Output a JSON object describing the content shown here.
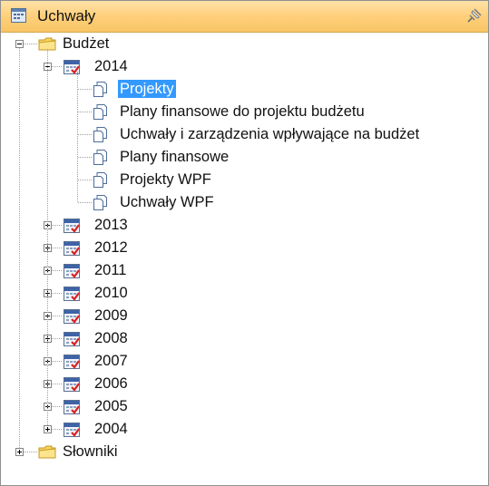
{
  "panel": {
    "title": "Uchwały"
  },
  "tree": {
    "root_budzet": "Budżet",
    "year_2014": "2014",
    "docs_2014": [
      "Projekty",
      "Plany finansowe do projektu budżetu",
      "Uchwały i zarządzenia wpływające na budżet",
      "Plany finansowe",
      "Projekty WPF",
      "Uchwały WPF"
    ],
    "years": [
      "2013",
      "2012",
      "2011",
      "2010",
      "2009",
      "2008",
      "2007",
      "2006",
      "2005",
      "2004"
    ],
    "root_slowniki": "Słowniki",
    "selected": "Projekty"
  }
}
